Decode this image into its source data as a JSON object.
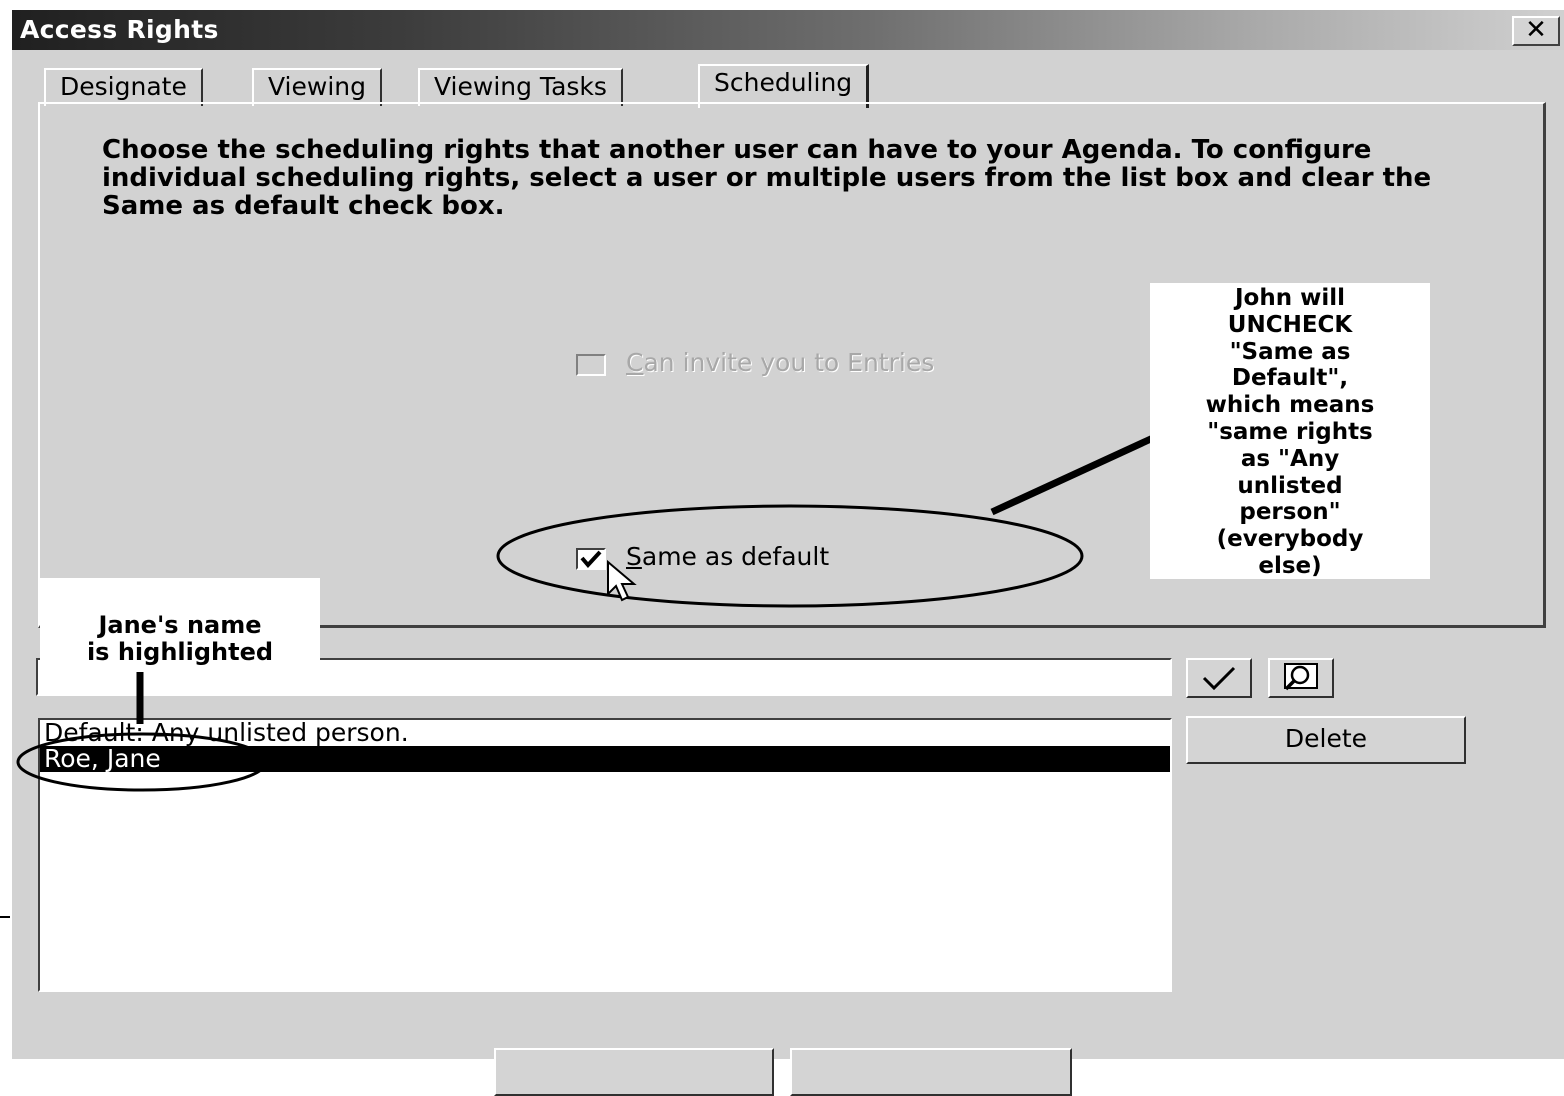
{
  "window": {
    "title": "Access Rights",
    "close_label": "✕"
  },
  "tabs": [
    {
      "label": "Designate",
      "active": false
    },
    {
      "label": "Viewing",
      "active": false
    },
    {
      "label": "Viewing Tasks",
      "active": false
    },
    {
      "label": "Scheduling",
      "active": true
    }
  ],
  "scheduling": {
    "instructions": "Choose the scheduling rights that another user can have to your Agenda. To configure individual scheduling rights, select a user or multiple users from the list box and clear the Same as default check box.",
    "invite": {
      "accel": "C",
      "rest": "an invite you to Entries",
      "checked": false,
      "disabled": true
    },
    "same_as_default": {
      "accel": "S",
      "rest": "ame as default",
      "checked": true
    }
  },
  "user_entry": {
    "value": "",
    "apply_icon": "check-icon",
    "lookup_icon": "address-book-icon"
  },
  "users_list": {
    "items": [
      {
        "label": "Default: Any unlisted person.",
        "selected": false
      },
      {
        "label": "Roe, Jane",
        "selected": true
      }
    ]
  },
  "buttons": {
    "delete": "Delete"
  },
  "annotations": {
    "john_note": [
      "John will",
      "UNCHECK",
      "\"Same as",
      "Default\",",
      "which means",
      "\"same rights",
      "as \"Any",
      "unlisted",
      "person\"",
      "(everybody",
      "else)"
    ],
    "jane_note": [
      "Jane's name",
      "is highlighted"
    ]
  }
}
